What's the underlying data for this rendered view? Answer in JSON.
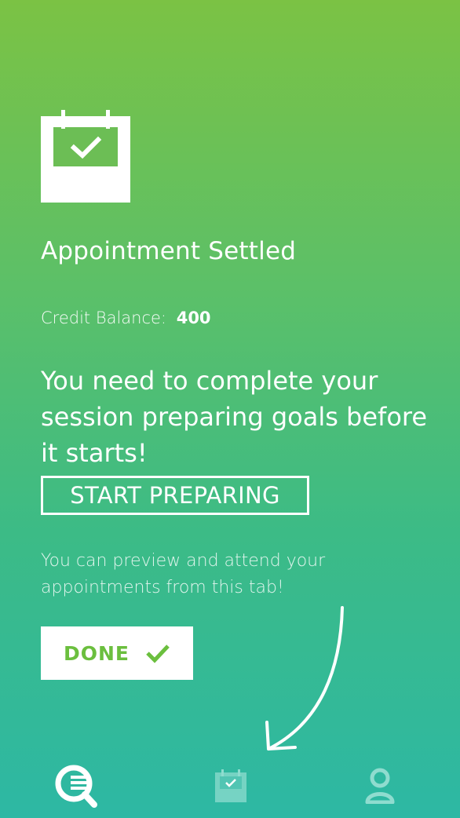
{
  "appointment": {
    "title": "Appointment Settled",
    "credit_label": "Credit Balance:",
    "credit_value": "400",
    "headline": "You need to complete your session preparing goals before it starts!",
    "prepare_button": "START PREPARING",
    "hint": "You can preview and attend your appointments from this tab!",
    "done_button": "DONE"
  },
  "icons": {
    "header": "calendar-check-icon",
    "done": "checkmark-icon",
    "arrow": "curved-arrow-icon"
  },
  "tabbar": {
    "tabs": [
      {
        "icon": "search-list-icon",
        "active": true
      },
      {
        "icon": "calendar-check-icon",
        "active": false
      },
      {
        "icon": "person-icon",
        "active": false
      }
    ]
  },
  "colors": {
    "gradient_top": "#7bc244",
    "gradient_bottom": "#2db8a4",
    "accent_green": "#6bbf3e",
    "white": "#ffffff"
  }
}
